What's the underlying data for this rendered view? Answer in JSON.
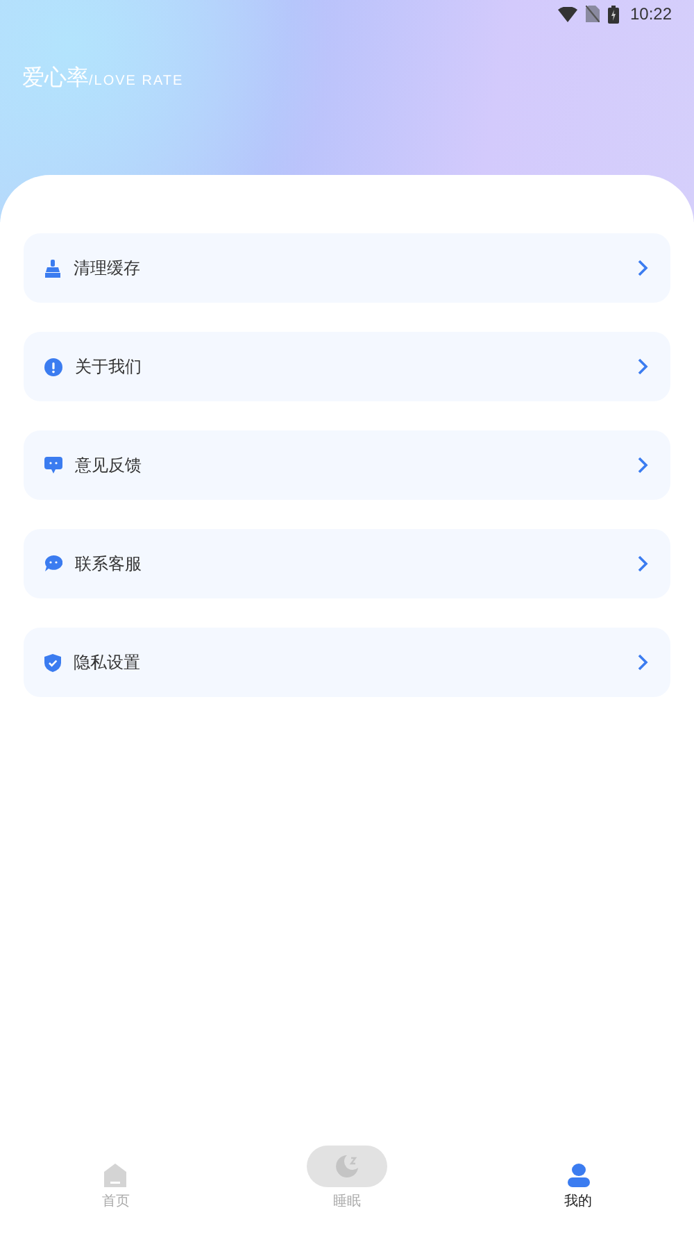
{
  "status_bar": {
    "time": "10:22"
  },
  "header": {
    "title": "爱心率",
    "subtitle": "/LOVE RATE"
  },
  "menu": [
    {
      "kind": "broom",
      "label": "清理缓存"
    },
    {
      "kind": "info",
      "label": "关于我们"
    },
    {
      "kind": "feedback",
      "label": "意见反馈"
    },
    {
      "kind": "chat",
      "label": "联系客服"
    },
    {
      "kind": "shield",
      "label": "隐私设置"
    }
  ],
  "tabs": [
    {
      "kind": "home",
      "label": "首页",
      "selected": false
    },
    {
      "kind": "sleep",
      "label": "睡眠",
      "selected": false
    },
    {
      "kind": "profile",
      "label": "我的",
      "selected": true
    }
  ]
}
